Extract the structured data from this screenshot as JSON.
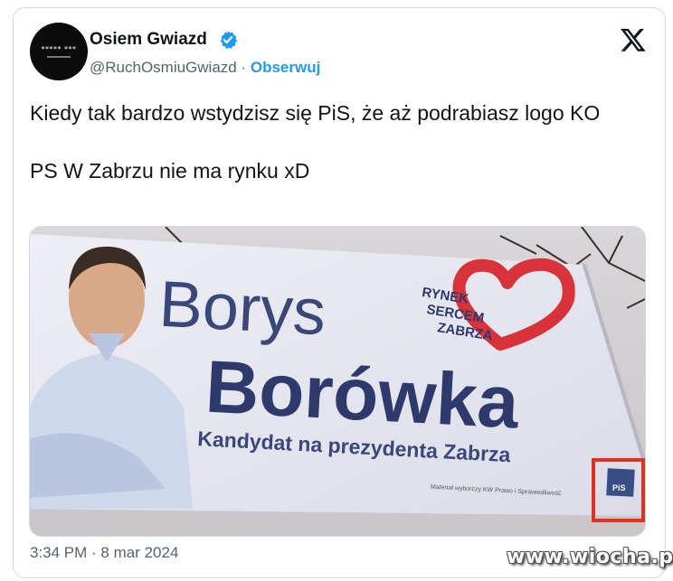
{
  "tweet": {
    "author_name": "Osiem Gwiazd",
    "avatar_text": "***** ***",
    "handle": "@RuchOsmiuGwiazd",
    "separator": " · ",
    "follow_label": "Obserwuj",
    "text_line1": "Kiedy tak bardzo wstydzisz się PiS, że aż podrabiasz logo KO",
    "text_line2": "PS W Zabrzu nie ma rynku xD",
    "timestamp": "3:34 PM · 8 mar 2024",
    "icons": {
      "verified": "verified-badge-icon",
      "platform": "x-logo-icon"
    }
  },
  "banner": {
    "first_name": "Borys",
    "last_name": "Borówka",
    "subtitle": "Kandydat na prezydenta Zabrza",
    "slogan_line1": "RYNEK",
    "slogan_line2": "SERCEM",
    "slogan_line3": "ZABRZA",
    "footer_note": "Materiał wyborczy KW Prawo i Sprawiedliwość",
    "party_logo_text": "PiS"
  },
  "watermark": "www.wiocha.pl",
  "colors": {
    "accent": "#1d9bf0",
    "text": "#0f1419",
    "muted": "#536471",
    "banner_navy": "#2d3a6b",
    "heart_red": "#d8323a",
    "highlight_box": "#e6301f"
  }
}
